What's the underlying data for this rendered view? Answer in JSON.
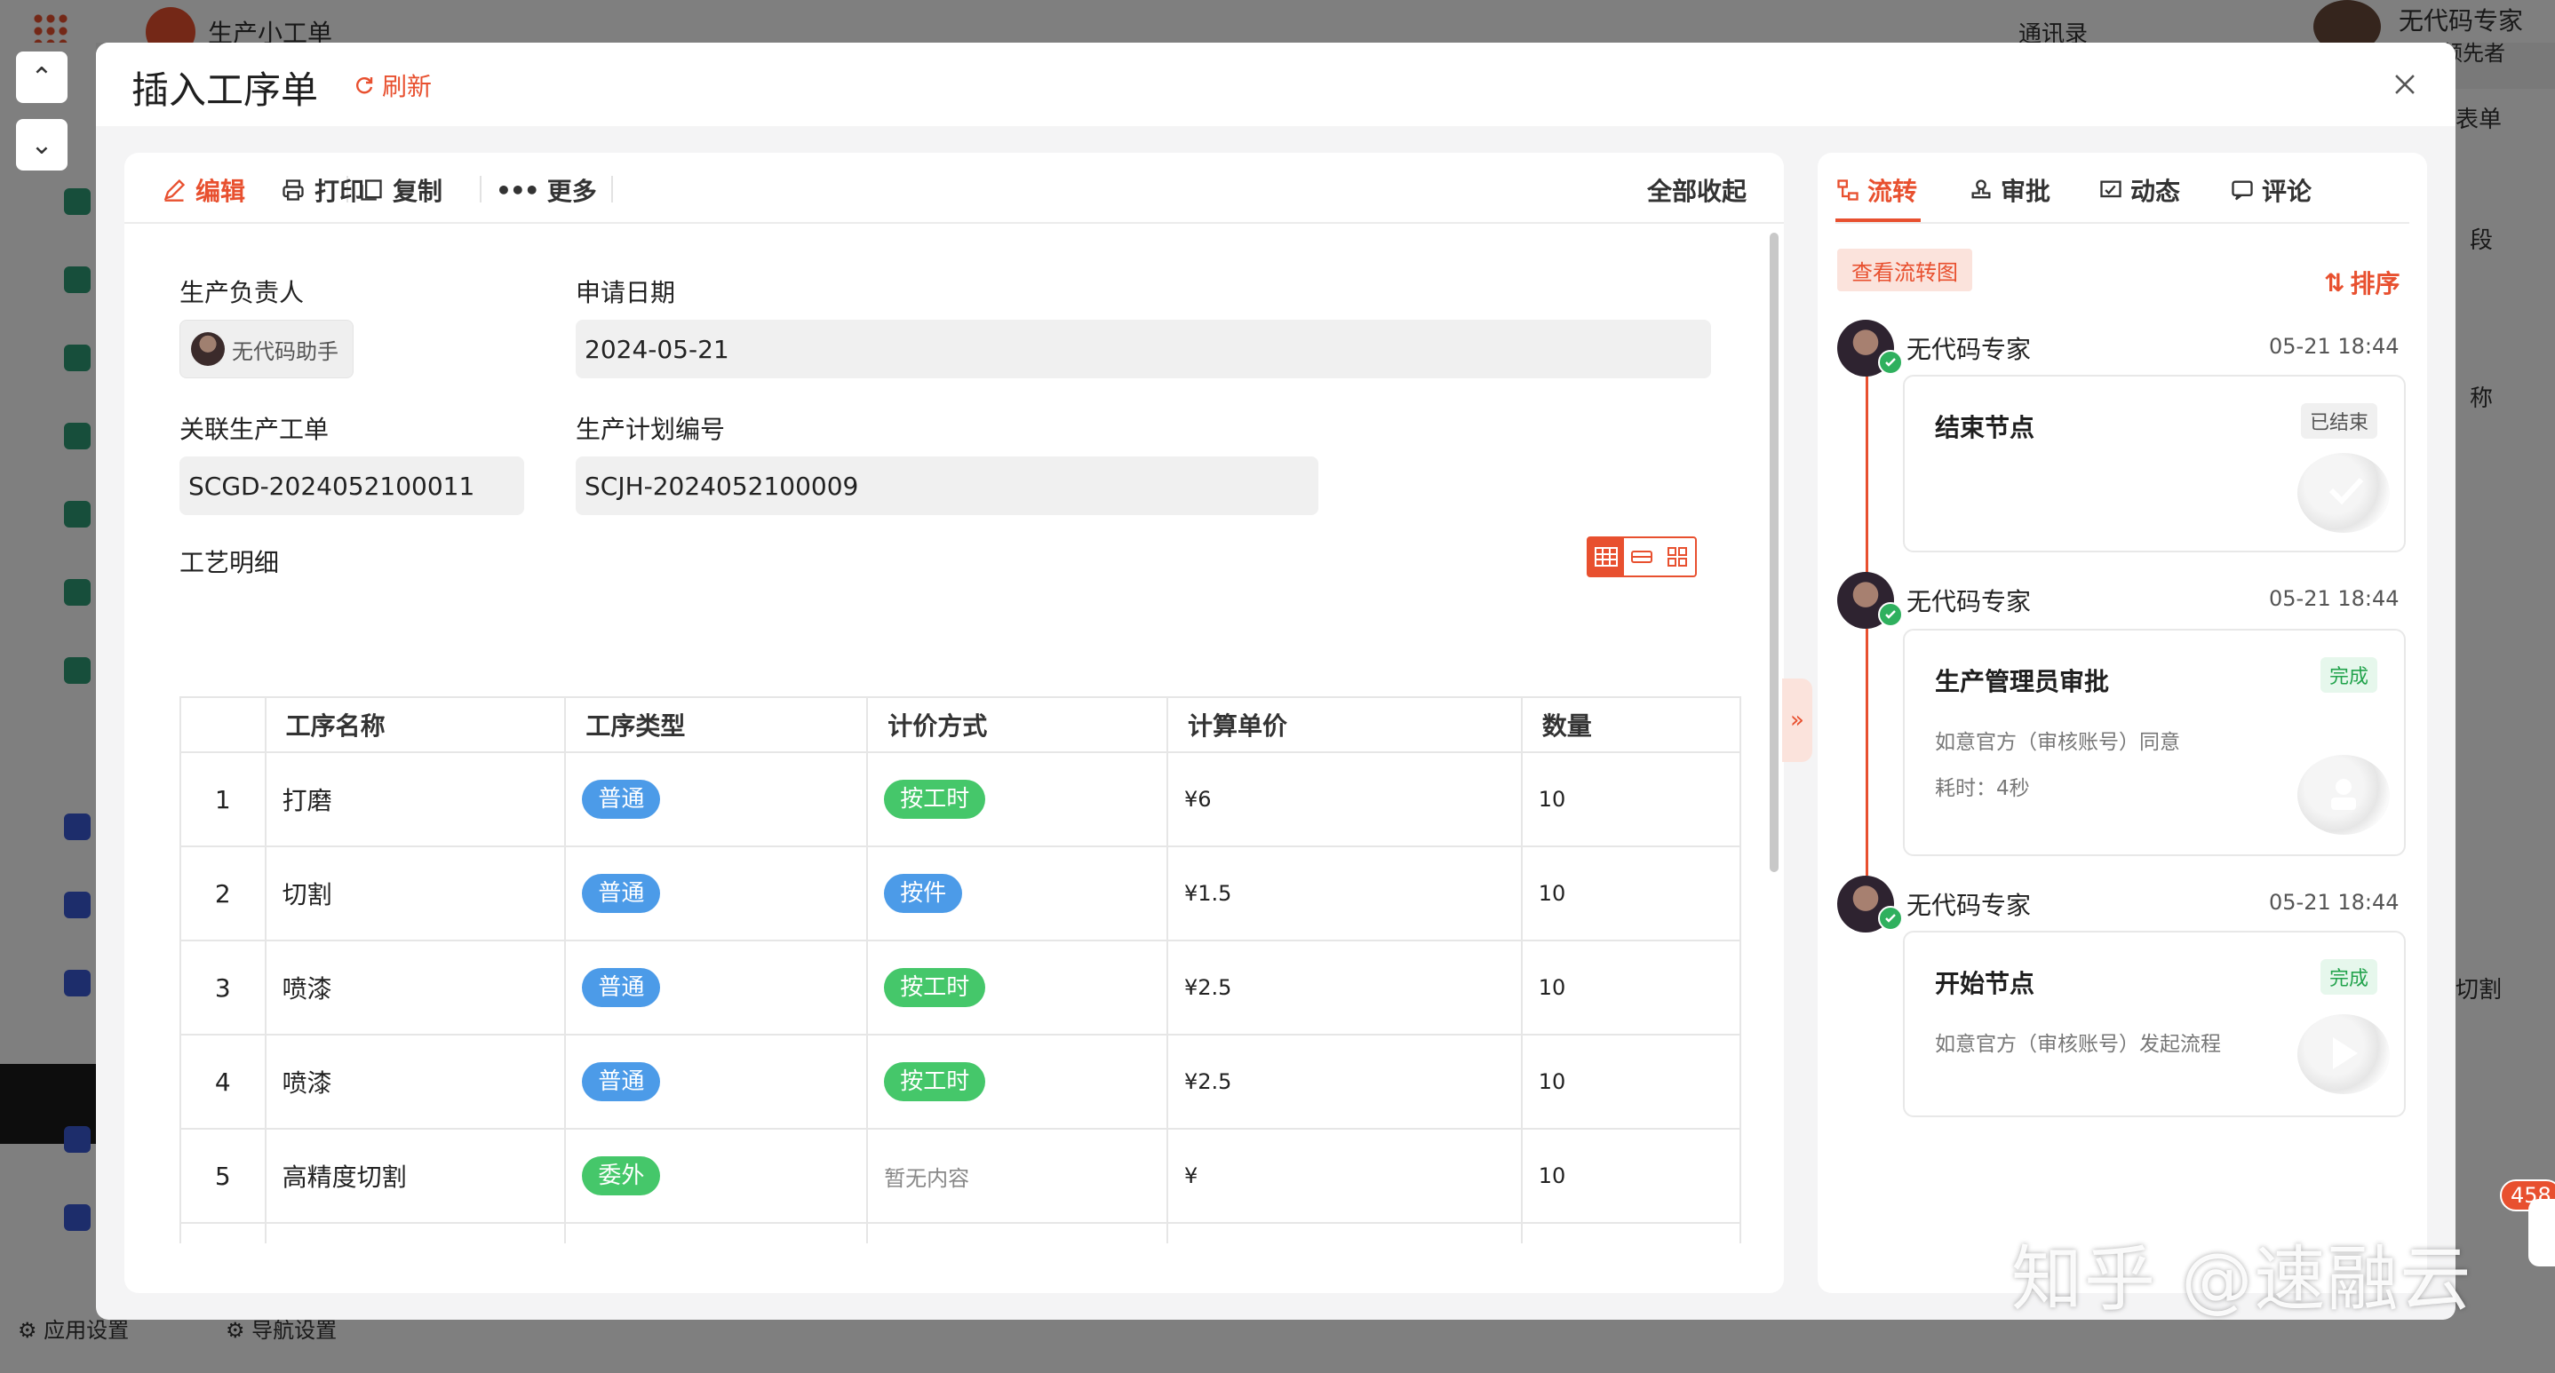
{
  "background": {
    "app_title": "生产小工单",
    "contacts": "通讯录",
    "top_user": "无代码专家",
    "top_user_sub": "领先者",
    "bottom_app_settings": "应用设置",
    "bottom_nav_settings": "导航设置",
    "right_fragments": [
      "表单",
      "段",
      "称",
      "切割"
    ],
    "notification_count": "458"
  },
  "modal": {
    "title": "插入工序单",
    "refresh_label": "刷新",
    "toolbar": {
      "edit": "编辑",
      "print": "打印",
      "copy": "复制",
      "more": "更多",
      "collapse_all": "全部收起"
    },
    "form": {
      "owner_label": "生产负责人",
      "owner_value": "无代码助手",
      "apply_date_label": "申请日期",
      "apply_date_value": "2024-05-21",
      "related_order_label": "关联生产工单",
      "related_order_value": "SCGD-2024052100011",
      "plan_no_label": "生产计划编号",
      "plan_no_value": "SCJH-2024052100009",
      "detail_label": "工艺明细"
    },
    "table": {
      "headers": [
        "",
        "工序名称",
        "工序类型",
        "计价方式",
        "计算单价",
        "数量"
      ],
      "rows": [
        {
          "idx": "1",
          "name": "打磨",
          "type": "普通",
          "type_color": "blue",
          "pricing": "按工时",
          "pricing_color": "green",
          "price": "¥6",
          "qty": "10"
        },
        {
          "idx": "2",
          "name": "切割",
          "type": "普通",
          "type_color": "blue",
          "pricing": "按件",
          "pricing_color": "blue",
          "price": "¥1.5",
          "qty": "10"
        },
        {
          "idx": "3",
          "name": "喷漆",
          "type": "普通",
          "type_color": "blue",
          "pricing": "按工时",
          "pricing_color": "green",
          "price": "¥2.5",
          "qty": "10"
        },
        {
          "idx": "4",
          "name": "喷漆",
          "type": "普通",
          "type_color": "blue",
          "pricing": "按工时",
          "pricing_color": "green",
          "price": "¥2.5",
          "qty": "10"
        },
        {
          "idx": "5",
          "name": "高精度切割",
          "type": "委外",
          "type_color": "green",
          "pricing": "暂无内容",
          "pricing_color": "none",
          "price": "¥",
          "qty": "10"
        }
      ]
    },
    "right": {
      "tabs": {
        "flow": "流转",
        "approve": "审批",
        "activity": "动态",
        "comment": "评论"
      },
      "view_flow_chart": "查看流转图",
      "sort": "排序",
      "timeline": [
        {
          "user": "无代码专家",
          "time": "05-21 18:44",
          "node": "结束节点",
          "status": "已结束",
          "lines": []
        },
        {
          "user": "无代码专家",
          "time": "05-21 18:44",
          "node": "生产管理员审批",
          "status": "完成",
          "lines": [
            "如意官方（审核账号）同意",
            "耗时：4秒"
          ]
        },
        {
          "user": "无代码专家",
          "time": "05-21 18:44",
          "node": "开始节点",
          "status": "完成",
          "lines": [
            "如意官方（审核账号）发起流程"
          ]
        }
      ]
    }
  },
  "watermark": "知乎 @速融云",
  "colors": {
    "accent": "#e8502f",
    "tag_blue": "#4c9be8",
    "tag_green": "#45c76a",
    "success": "#22a34c"
  }
}
